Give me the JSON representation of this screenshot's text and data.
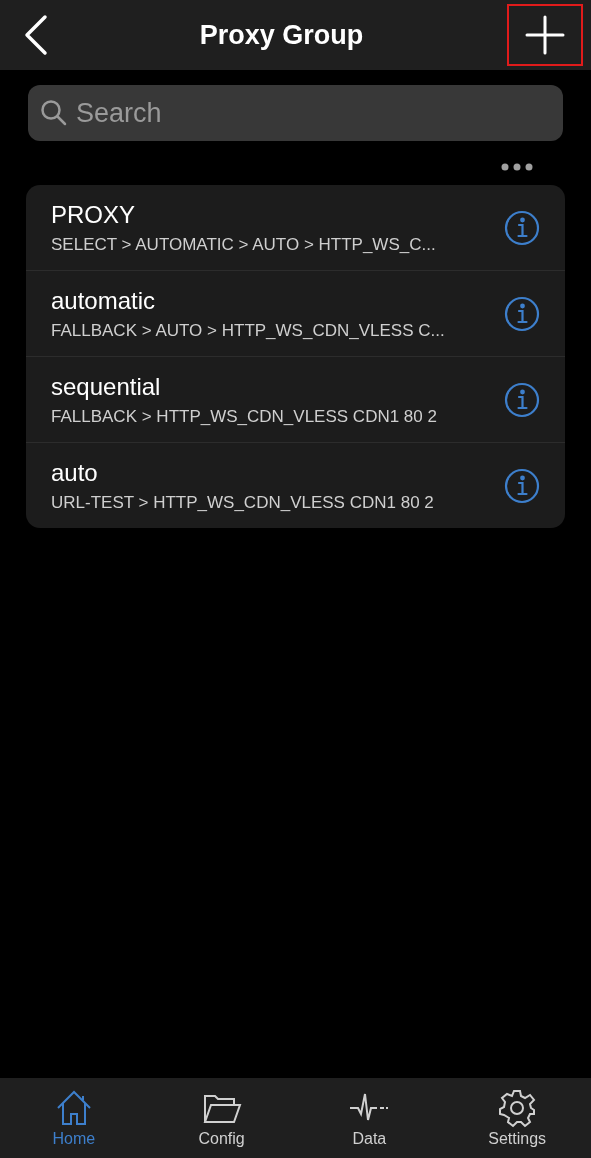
{
  "nav_bar": {
    "title": "Proxy Group",
    "add_highlighted": true
  },
  "search": {
    "placeholder": "Search"
  },
  "groups": [
    {
      "name": "PROXY",
      "chain": "SELECT > AUTOMATIC > AUTO > HTTP_WS_C..."
    },
    {
      "name": "automatic",
      "chain": "FALLBACK > AUTO > HTTP_WS_CDN_VLESS C..."
    },
    {
      "name": "sequential",
      "chain": "FALLBACK > HTTP_WS_CDN_VLESS CDN1 80 2"
    },
    {
      "name": "auto",
      "chain": "URL-TEST > HTTP_WS_CDN_VLESS CDN1 80 2"
    }
  ],
  "tab_bar": [
    {
      "kind": "home",
      "label": "Home",
      "selected": true
    },
    {
      "kind": "config",
      "label": "Config",
      "selected": false
    },
    {
      "kind": "data",
      "label": "Data",
      "selected": false
    },
    {
      "kind": "settings",
      "label": "Settings",
      "selected": false
    }
  ]
}
